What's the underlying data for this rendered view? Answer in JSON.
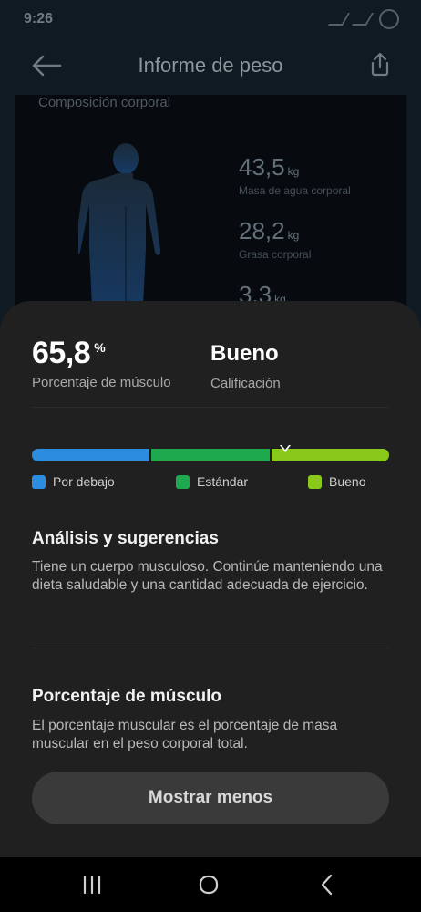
{
  "status_bar": {
    "time": "9:26"
  },
  "app_bar": {
    "title": "Informe de peso",
    "back_icon": "arrow-left-icon",
    "share_icon": "share-icon"
  },
  "background_card": {
    "section_title": "Composición corporal",
    "stats": [
      {
        "value": "43,5",
        "unit": "kg",
        "label": "Masa de agua corporal"
      },
      {
        "value": "28,2",
        "unit": "kg",
        "label": "Grasa corporal"
      },
      {
        "value": "3,3",
        "unit": "kg",
        "label": ""
      }
    ]
  },
  "sheet": {
    "muscle_value": "65,8",
    "muscle_unit": "%",
    "muscle_label": "Porcentaje de músculo",
    "rating_value": "Bueno",
    "rating_label": "Calificación",
    "scale": {
      "segments": [
        {
          "name": "Por debajo",
          "color": "#2c8de0"
        },
        {
          "name": "Estándar",
          "color": "#1ea94f"
        },
        {
          "name": "Bueno",
          "color": "#8ac91c"
        }
      ],
      "marker_segment": "Bueno"
    },
    "analysis_title": "Análisis y sugerencias",
    "analysis_text": "Tiene un cuerpo musculoso. Continúe manteniendo una dieta saludable y una cantidad adecuada de ejercicio.",
    "definition_title": "Porcentaje de músculo",
    "definition_text": "El porcentaje muscular es el porcentaje de masa muscular en el peso corporal total.",
    "collapse_button": "Mostrar menos"
  },
  "nav_bar": {
    "icons": [
      "recent-apps-icon",
      "home-icon",
      "back-nav-icon"
    ]
  }
}
